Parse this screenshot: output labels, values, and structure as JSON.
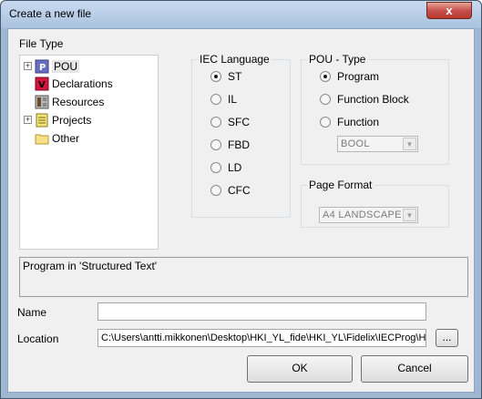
{
  "window": {
    "title": "Create a new file",
    "close_label": "x"
  },
  "file_type": {
    "label": "File Type",
    "items": [
      {
        "label": "POU",
        "icon": "pou-icon",
        "expandable": true,
        "selected": true
      },
      {
        "label": "Declarations",
        "icon": "declarations-icon",
        "expandable": false,
        "selected": false
      },
      {
        "label": "Resources",
        "icon": "resources-icon",
        "expandable": false,
        "selected": false
      },
      {
        "label": "Projects",
        "icon": "projects-icon",
        "expandable": true,
        "selected": false
      },
      {
        "label": "Other",
        "icon": "folder-icon",
        "expandable": false,
        "selected": false
      }
    ]
  },
  "iec_language": {
    "label": "IEC Language",
    "options": [
      "ST",
      "IL",
      "SFC",
      "FBD",
      "LD",
      "CFC"
    ],
    "selected": "ST"
  },
  "pou_type": {
    "label": "POU - Type",
    "options": [
      "Program",
      "Function Block",
      "Function"
    ],
    "selected": "Program",
    "return_type": "BOOL"
  },
  "page_format": {
    "label": "Page Format",
    "value": "A4 LANDSCAPE"
  },
  "description": "Program in 'Structured Text'",
  "name": {
    "label": "Name",
    "value": ""
  },
  "location": {
    "label": "Location",
    "value": "C:\\Users\\antti.mikkonen\\Desktop\\HKI_YL_fide\\HKI_YL\\Fidelix\\IECProg\\H",
    "browse_label": "..."
  },
  "buttons": {
    "ok": "OK",
    "cancel": "Cancel"
  }
}
